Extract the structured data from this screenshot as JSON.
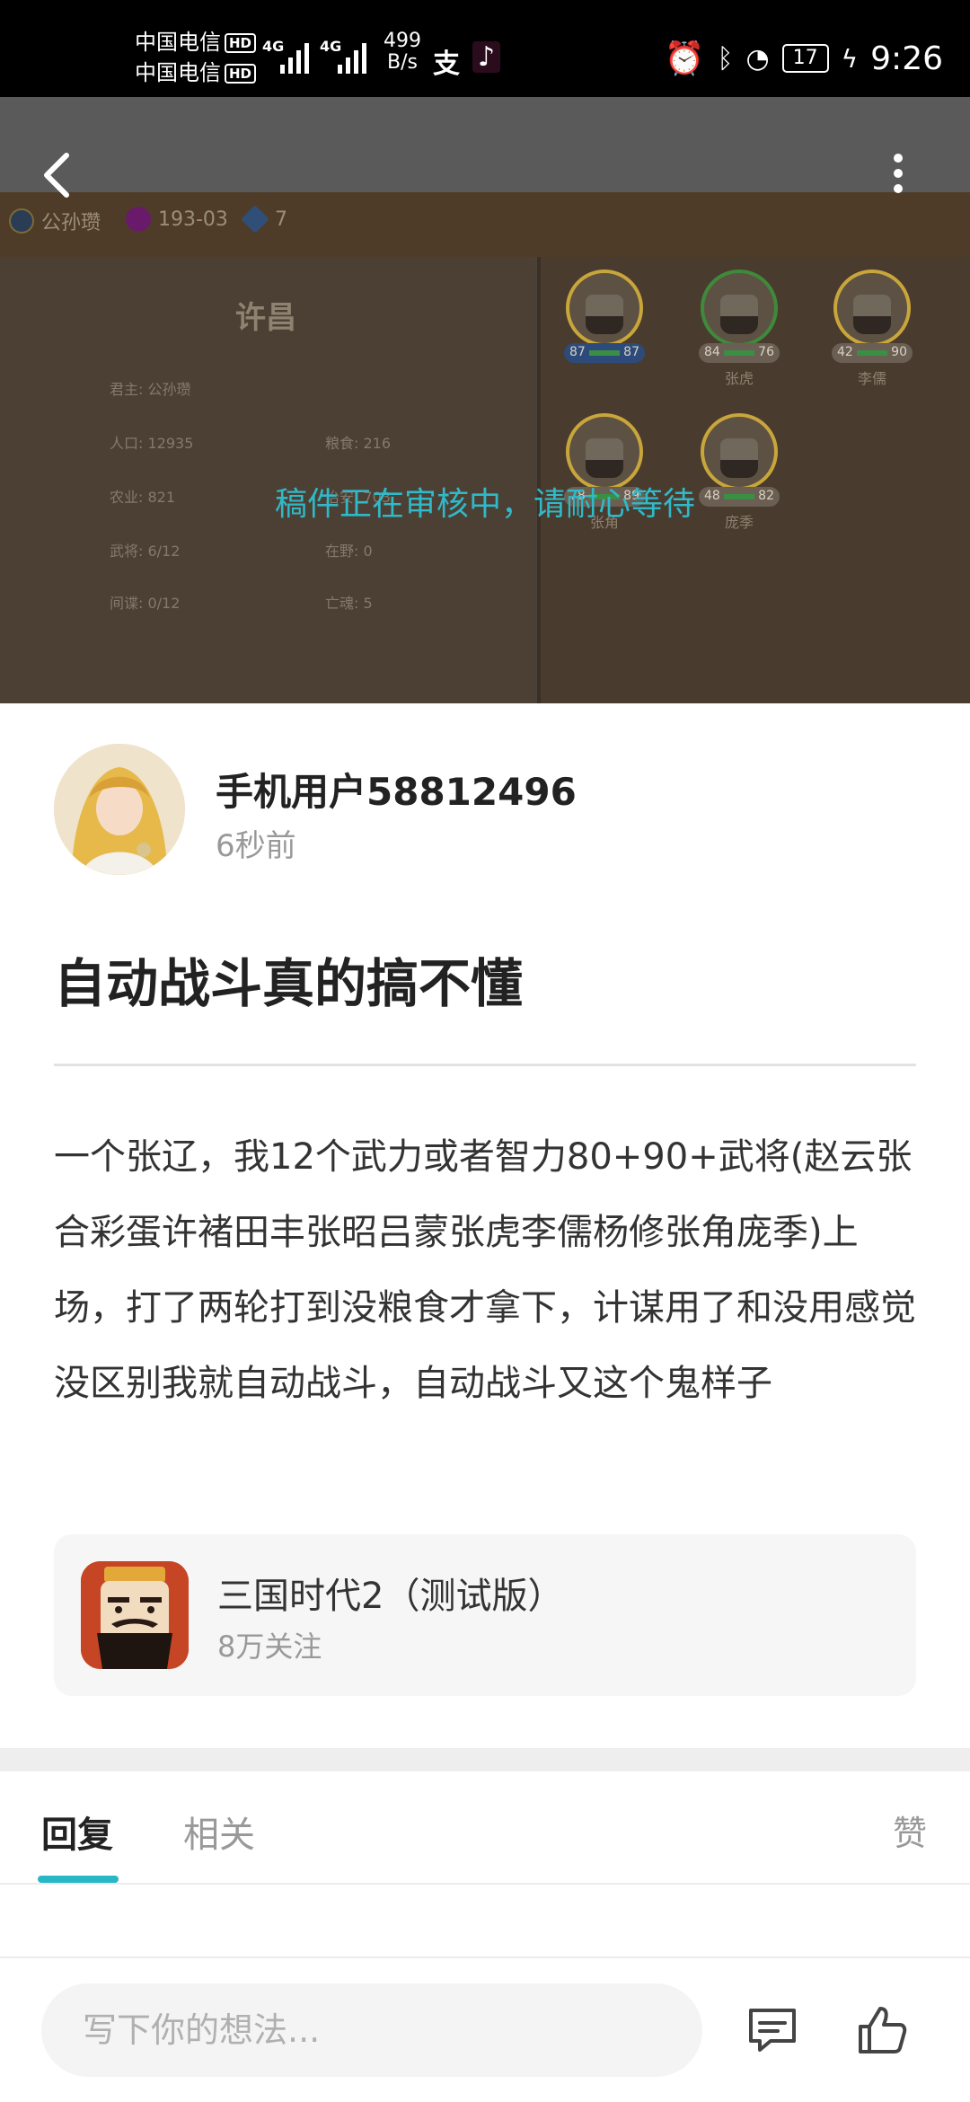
{
  "status_bar": {
    "carrier1": "中国电信",
    "carrier2": "中国电信",
    "hd_label": "HD",
    "network": "4G",
    "speed_value": "499",
    "speed_unit": "B/s",
    "battery": "17",
    "time": "9:26"
  },
  "hero": {
    "resource_lord": "公孙瓒",
    "resource_date": "193-03",
    "resource_count": "7",
    "city": "许昌",
    "stats": [
      {
        "label": "君主: 公孙瓒"
      },
      {
        "label": "人口: 12935"
      },
      {
        "label": "粮食: 216"
      },
      {
        "label": "农业: 821"
      },
      {
        "label": "治安: 703"
      },
      {
        "label": "武将: 6/12"
      },
      {
        "label": "在野: 0"
      },
      {
        "label": "间谍: 0/12"
      },
      {
        "label": "亡魂: 5"
      }
    ],
    "generals": [
      {
        "left": "87",
        "right": "87",
        "name": ""
      },
      {
        "left": "84",
        "right": "76",
        "name": "张虎"
      },
      {
        "left": "42",
        "right": "90",
        "name": "李儒"
      },
      {
        "left": "78",
        "right": "89",
        "name": "张角"
      },
      {
        "left": "48",
        "right": "82",
        "name": "庞季"
      }
    ],
    "review_message": "稿件正在审核中，请耐心等待"
  },
  "post": {
    "username": "手机用户58812496",
    "time": "6秒前",
    "title": "自动战斗真的搞不懂",
    "body": "一个张辽，我12个武力或者智力80+90+武将(赵云张合彩蛋许褚田丰张昭吕蒙张虎李儒杨修张角庞季)上场，打了两轮打到没粮食才拿下，计谋用了和没用感觉没区别我就自动战斗，自动战斗又这个鬼样子"
  },
  "game_card": {
    "name": "三国时代2（测试版）",
    "followers": "8万关注"
  },
  "tabs": {
    "reply": "回复",
    "related": "相关",
    "like": "赞"
  },
  "comment_bar": {
    "placeholder": "写下你的想法..."
  },
  "colors": {
    "accent": "#28b7c6",
    "review_text": "#2fb9c9"
  },
  "icons": {
    "back": "back-arrow-icon",
    "more": "more-vertical-icon",
    "comment": "comment-icon",
    "like": "thumbs-up-icon"
  }
}
